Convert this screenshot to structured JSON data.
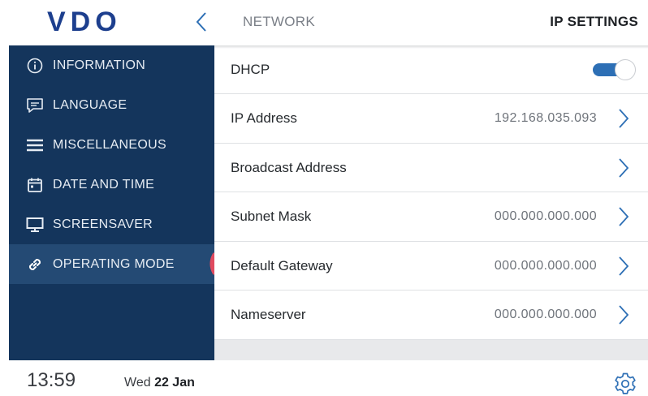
{
  "header": {
    "logo_text": "VDO",
    "breadcrumb": "NETWORK",
    "title": "IP SETTINGS",
    "back_icon": "chevron-left-icon"
  },
  "sidebar": {
    "items": [
      {
        "label": "INFORMATION",
        "icon": "info-icon",
        "active": false
      },
      {
        "label": "LANGUAGE",
        "icon": "speech-bubble-icon",
        "active": false
      },
      {
        "label": "MISCELLANEOUS",
        "icon": "menu-icon",
        "active": false
      },
      {
        "label": "DATE AND TIME",
        "icon": "calendar-icon",
        "active": false
      },
      {
        "label": "SCREENSAVER",
        "icon": "monitor-icon",
        "active": false
      },
      {
        "label": "OPERATING MODE",
        "icon": "link-icon",
        "active": true
      }
    ]
  },
  "settings": {
    "dhcp": {
      "label": "DHCP",
      "enabled": true
    },
    "rows": [
      {
        "label": "IP Address",
        "value": "192.168.035.093"
      },
      {
        "label": "Broadcast Address",
        "value": ""
      },
      {
        "label": "Subnet Mask",
        "value": "000.000.000.000"
      },
      {
        "label": "Default Gateway",
        "value": "000.000.000.000"
      },
      {
        "label": "Nameserver",
        "value": "000.000.000.000"
      }
    ]
  },
  "footer": {
    "time": "13:59",
    "day": "Wed",
    "date": "22 Jan",
    "settings_icon": "gear-icon"
  },
  "colors": {
    "brand_navy": "#14355c",
    "active_item": "#244a74",
    "accent_blue": "#2d6fb5",
    "marker_red": "#e04a5f"
  }
}
